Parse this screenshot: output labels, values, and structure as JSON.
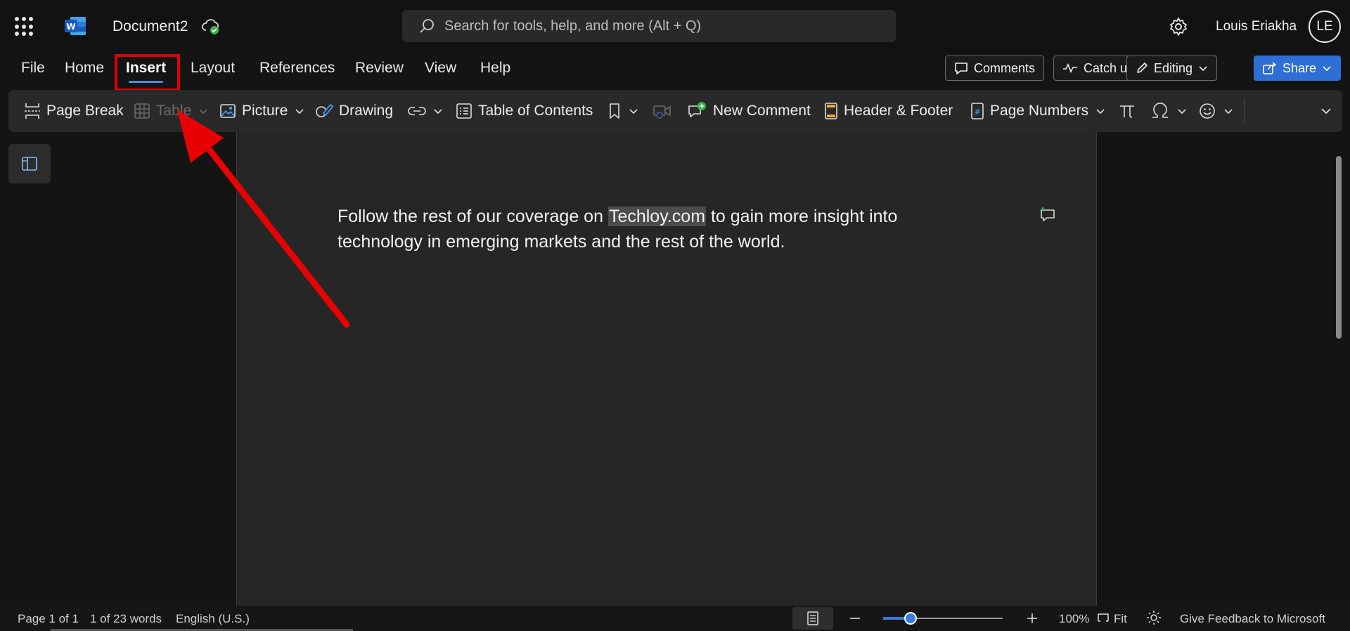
{
  "titlebar": {
    "doc_title": "Document2",
    "search_placeholder": "Search for tools, help, and more (Alt + Q)",
    "user_name": "Louis Eriakha",
    "avatar_initials": "LE"
  },
  "tabs": [
    "File",
    "Home",
    "Insert",
    "Layout",
    "References",
    "Review",
    "View",
    "Help"
  ],
  "active_tab": "Insert",
  "top_buttons": {
    "comments": "Comments",
    "catch_up": "Catch up",
    "editing": "Editing",
    "share": "Share"
  },
  "ribbon": {
    "page_break": "Page Break",
    "table": "Table",
    "picture": "Picture",
    "drawing": "Drawing",
    "table_of_contents": "Table of Contents",
    "new_comment": "New Comment",
    "header_footer": "Header & Footer",
    "page_numbers": "Page Numbers"
  },
  "document": {
    "text_before": "Follow the rest of our coverage on ",
    "link": "Techloy.com",
    "text_after": " to gain more insight into technology in emerging markets and the rest of the world."
  },
  "statusbar": {
    "page": "Page 1 of 1",
    "words": "1 of 23 words",
    "language": "English (U.S.)",
    "zoom": "100%",
    "fit": "Fit",
    "feedback": "Give Feedback to Microsoft"
  },
  "colors": {
    "accent": "#2e6fd6",
    "highlight_annotation": "#e00000",
    "word_brand": "#185abd"
  }
}
